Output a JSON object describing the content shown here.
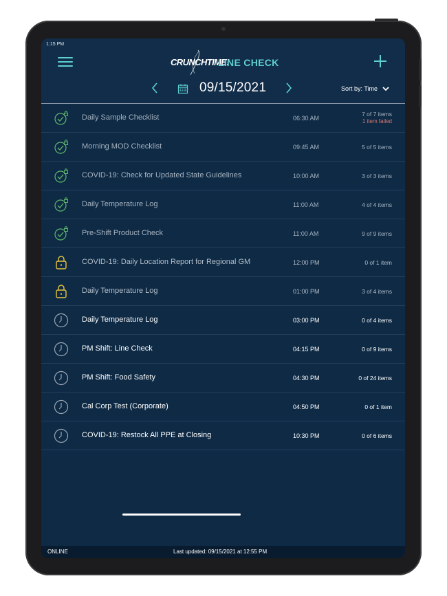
{
  "status_bar": {
    "time": "1:15 PM"
  },
  "header": {
    "brand": "CRUNCHTIME!",
    "product": "LINE CHECK",
    "date": "09/15/2021",
    "sort_label": "Sort by: Time"
  },
  "icons": {
    "menu": "hamburger-menu-icon",
    "add": "plus-icon",
    "prev": "chevron-left-icon",
    "next": "chevron-right-icon",
    "calendar": "calendar-icon",
    "sort": "chevron-down-icon",
    "completed": "check-lock-icon",
    "locked": "lock-icon",
    "pending": "clock-icon"
  },
  "colors": {
    "background": "#0e2a45",
    "accent": "#5fcfcf",
    "completed_icon": "#5fb86b",
    "locked_icon": "#e8c43a",
    "pending_icon": "#9aa6b4",
    "failed_text": "#d9776f"
  },
  "checklists": [
    {
      "name": "Daily Sample Checklist",
      "time": "06:30 AM",
      "count": "7 of 7 items",
      "failed": "1 item failed",
      "status": "completed"
    },
    {
      "name": "Morning MOD Checklist",
      "time": "09:45 AM",
      "count": "5 of 5 items",
      "status": "completed"
    },
    {
      "name": "COVID-19: Check for Updated State Guidelines",
      "time": "10:00 AM",
      "count": "3 of 3 items",
      "status": "completed"
    },
    {
      "name": "Daily Temperature Log",
      "time": "11:00 AM",
      "count": "4 of 4 items",
      "status": "completed"
    },
    {
      "name": "Pre-Shift Product Check",
      "time": "11:00 AM",
      "count": "9 of 9 items",
      "status": "completed"
    },
    {
      "name": "COVID-19: Daily Location Report for Regional GM",
      "time": "12:00 PM",
      "count": "0 of 1 item",
      "status": "locked"
    },
    {
      "name": "Daily Temperature Log",
      "time": "01:00 PM",
      "count": "3 of 4 items",
      "status": "locked"
    },
    {
      "name": "Daily Temperature Log",
      "time": "03:00 PM",
      "count": "0 of 4 items",
      "status": "pending"
    },
    {
      "name": "PM Shift: Line Check",
      "time": "04:15 PM",
      "count": "0 of 9 items",
      "status": "pending"
    },
    {
      "name": "PM Shift: Food Safety",
      "time": "04:30 PM",
      "count": "0 of 24 items",
      "status": "pending"
    },
    {
      "name": "Cal Corp Test (Corporate)",
      "time": "04:50 PM",
      "count": "0 of 1 item",
      "status": "pending"
    },
    {
      "name": "COVID-19: Restock All PPE at Closing",
      "time": "10:30 PM",
      "count": "0 of 6 items",
      "status": "pending"
    }
  ],
  "footer": {
    "connection": "ONLINE",
    "last_updated": "Last updated: 09/15/2021 at 12:55 PM"
  }
}
